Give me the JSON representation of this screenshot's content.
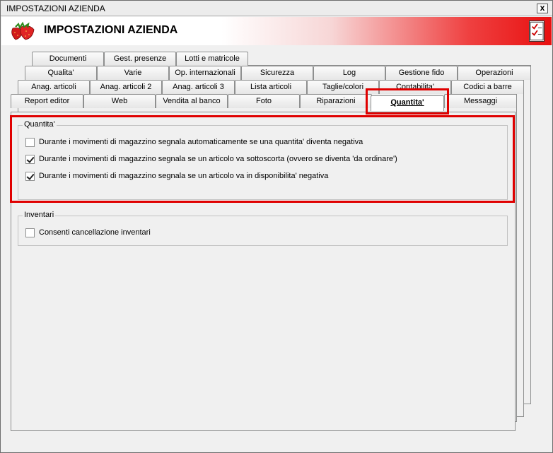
{
  "window": {
    "title": "IMPOSTAZIONI AZIENDA",
    "close_label": "x"
  },
  "header": {
    "title": "IMPOSTAZIONI AZIENDA"
  },
  "tabs": {
    "row1": [
      "Documenti",
      "Gest. presenze",
      "Lotti e matricole"
    ],
    "row2": [
      "Qualita'",
      "Varie",
      "Op. internazionali",
      "Sicurezza",
      "Log",
      "Gestione fido",
      "Operazioni"
    ],
    "row3": [
      "Anag. articoli",
      "Anag. articoli 2",
      "Anag. articoli 3",
      "Lista articoli",
      "Taglie/colori",
      "Contabilita'",
      "Codici a barre"
    ],
    "row4": [
      "Report editor",
      "Web",
      "Vendita al banco",
      "Foto",
      "Riparazioni",
      "Quantita'",
      "Messaggi"
    ],
    "active": "Quantita'"
  },
  "quantita_group": {
    "legend": "Quantita'",
    "options": [
      {
        "label": "Durante i movimenti di magazzino segnala automaticamente se una quantita' diventa negativa",
        "checked": false
      },
      {
        "label": "Durante i movimenti di magazzino segnala se un articolo va sottoscorta (ovvero se diventa 'da ordinare')",
        "checked": true
      },
      {
        "label": "Durante i movimenti di magazzino segnala se un articolo va in disponibilita' negativa",
        "checked": true
      }
    ]
  },
  "inventari_group": {
    "legend": "Inventari",
    "options": [
      {
        "label": "Consenti cancellazione inventari",
        "checked": false
      }
    ]
  },
  "colors": {
    "highlight": "#e00000",
    "header_gradient_end": "#e81010"
  }
}
